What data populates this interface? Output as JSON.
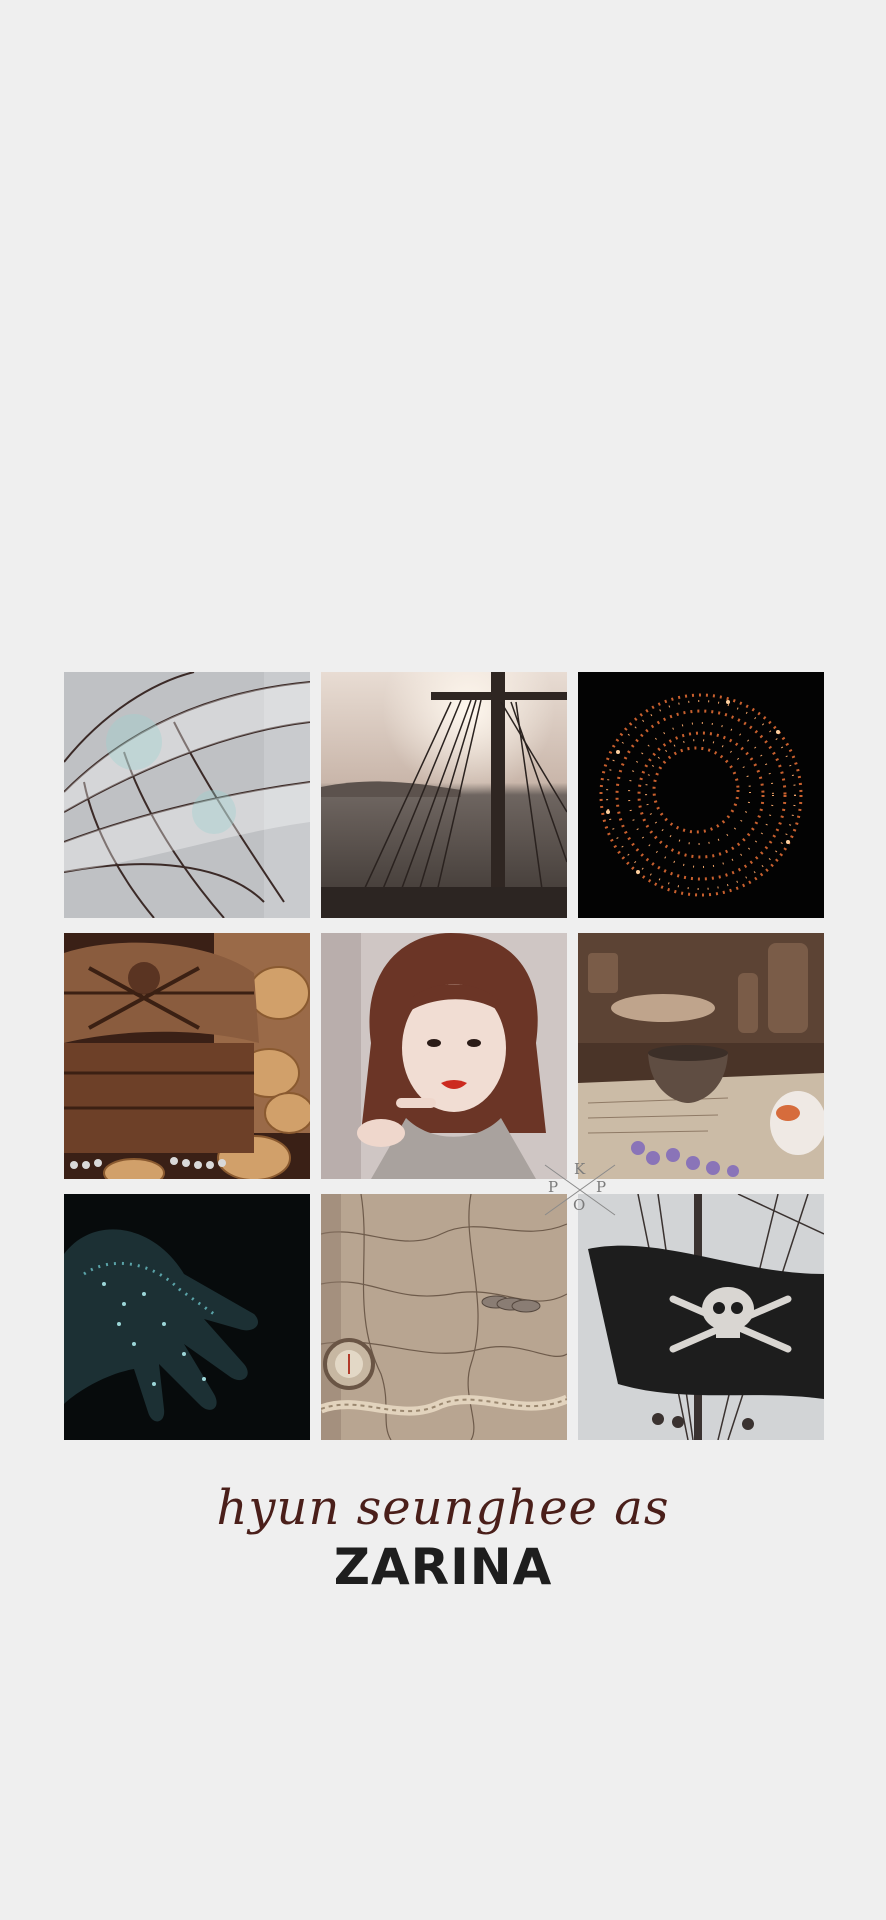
{
  "caption": {
    "script_line": "hyun seunghee as",
    "name_line": "ZARINA"
  },
  "watermark": {
    "letters": [
      "K",
      "P",
      "P",
      "O"
    ]
  },
  "tiles": [
    {
      "id": "fairy-wings",
      "colors": [
        "#b9bcc0",
        "#3a2a28"
      ]
    },
    {
      "id": "ship-rigging-sea",
      "colors": [
        "#c8b9ae",
        "#4a3d36"
      ]
    },
    {
      "id": "spiral-sparks",
      "colors": [
        "#050505",
        "#e07a3c"
      ]
    },
    {
      "id": "treasure-chest-coins",
      "colors": [
        "#6a3f2a",
        "#c9955c"
      ]
    },
    {
      "id": "portrait",
      "colors": [
        "#cfc6c4",
        "#6d3a2a"
      ]
    },
    {
      "id": "apothecary-table",
      "colors": [
        "#5e4637",
        "#c7b8a4"
      ]
    },
    {
      "id": "glittering-hand",
      "colors": [
        "#0a1112",
        "#4e8f95"
      ]
    },
    {
      "id": "map-compass",
      "colors": [
        "#b9a58f",
        "#6b5646"
      ]
    },
    {
      "id": "pirate-flag",
      "colors": [
        "#d3d4d6",
        "#1c1c1c"
      ]
    }
  ]
}
